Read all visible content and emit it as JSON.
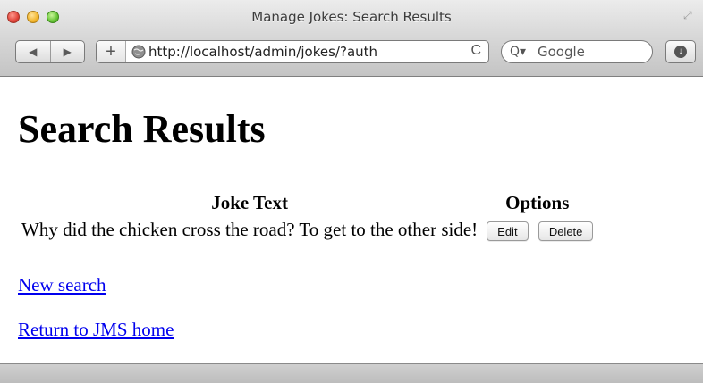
{
  "window": {
    "title": "Manage Jokes: Search Results"
  },
  "toolbar": {
    "back_glyph": "◀",
    "forward_glyph": "▶",
    "new_tab_glyph": "+",
    "url": "http://localhost/admin/jokes/?auth",
    "reload_glyph": "C",
    "search_icon_glyph": "Q▾",
    "search_placeholder": "Google"
  },
  "page": {
    "heading": "Search Results",
    "table": {
      "headers": [
        "Joke Text",
        "Options"
      ],
      "rows": [
        {
          "text": "Why did the chicken cross the road? To get to the other side!",
          "edit_label": "Edit",
          "delete_label": "Delete"
        }
      ]
    },
    "links": {
      "new_search": "New search",
      "home": "Return to JMS home"
    }
  },
  "colors": {
    "link": "#0000ee",
    "chrome_top": "#ececec",
    "chrome_bottom": "#c4c4c4"
  }
}
